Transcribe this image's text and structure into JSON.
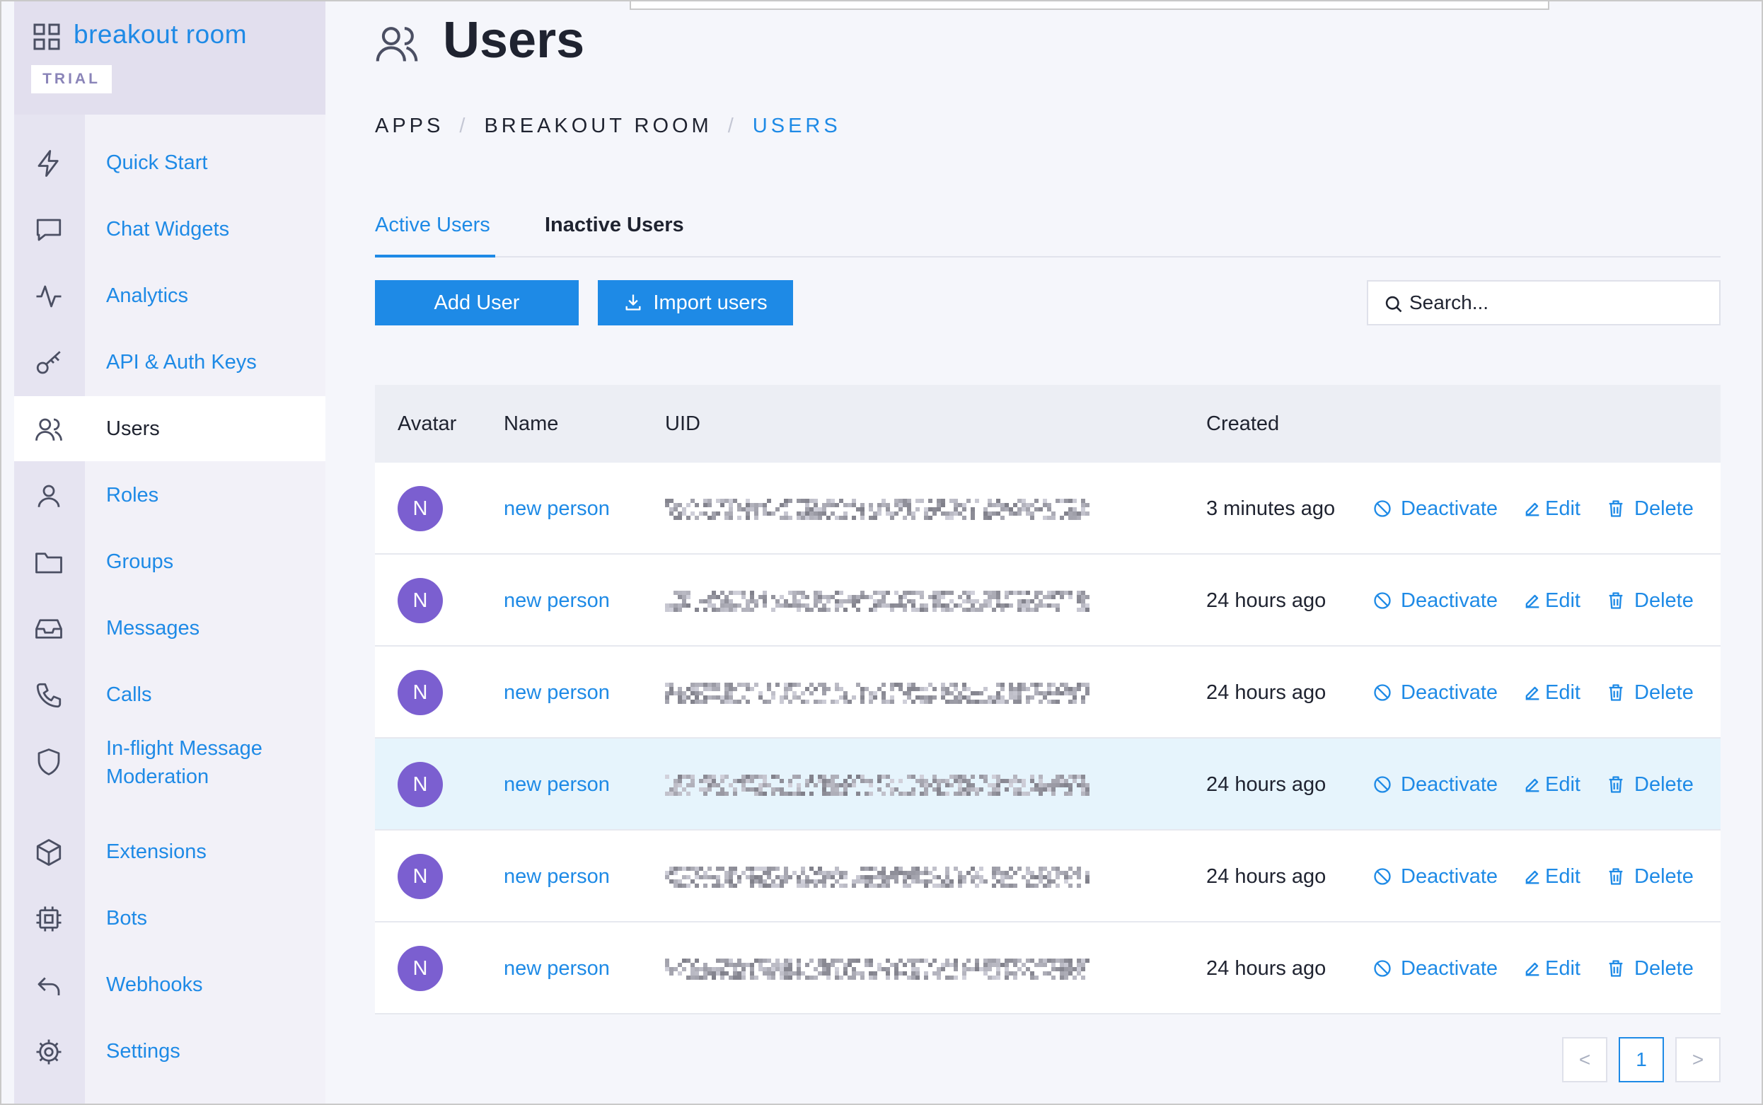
{
  "app": {
    "name": "breakout room",
    "plan_badge": "TRIAL"
  },
  "nav": [
    {
      "label": "Quick Start",
      "icon": "lightning-icon"
    },
    {
      "label": "Chat Widgets",
      "icon": "chat-bubble-icon"
    },
    {
      "label": "Analytics",
      "icon": "activity-icon"
    },
    {
      "label": "API & Auth Keys",
      "icon": "key-icon"
    },
    {
      "label": "Users",
      "icon": "users-icon",
      "active": true
    },
    {
      "label": "Roles",
      "icon": "user-icon"
    },
    {
      "label": "Groups",
      "icon": "folder-icon"
    },
    {
      "label": "Messages",
      "icon": "inbox-icon"
    },
    {
      "label": "Calls",
      "icon": "phone-icon"
    },
    {
      "label": "In-flight Message Moderation",
      "icon": "shield-icon"
    },
    {
      "label": "Extensions",
      "icon": "cube-icon"
    },
    {
      "label": "Bots",
      "icon": "cpu-icon"
    },
    {
      "label": "Webhooks",
      "icon": "return-arrow-icon"
    },
    {
      "label": "Settings",
      "icon": "gear-icon"
    }
  ],
  "page": {
    "title": "Users",
    "breadcrumb": [
      "APPS",
      "BREAKOUT ROOM",
      "USERS"
    ]
  },
  "tabs": {
    "active": "Active Users",
    "inactive": "Inactive Users"
  },
  "toolbar": {
    "add_label": "Add User",
    "import_label": "Import users",
    "search_placeholder": "Search..."
  },
  "table": {
    "columns": [
      "Avatar",
      "Name",
      "UID",
      "Created"
    ],
    "actions": {
      "deactivate": "Deactivate",
      "edit": "Edit",
      "delete": "Delete"
    },
    "rows": [
      {
        "initial": "N",
        "name": "new person",
        "created": "3 minutes ago"
      },
      {
        "initial": "N",
        "name": "new person",
        "created": "24 hours ago"
      },
      {
        "initial": "N",
        "name": "new person",
        "created": "24 hours ago"
      },
      {
        "initial": "N",
        "name": "new person",
        "created": "24 hours ago",
        "highlighted": true
      },
      {
        "initial": "N",
        "name": "new person",
        "created": "24 hours ago"
      },
      {
        "initial": "N",
        "name": "new person",
        "created": "24 hours ago"
      }
    ]
  },
  "pagination": {
    "prev": "<",
    "current": "1",
    "next": ">"
  },
  "colors": {
    "accent": "#1e8ae6",
    "avatar": "#7b5fd0",
    "row_highlight": "#e6f4fc"
  }
}
